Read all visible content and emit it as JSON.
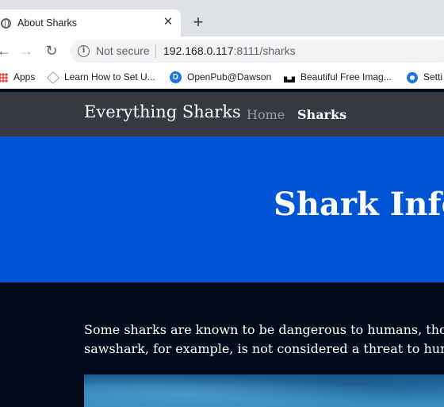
{
  "browser": {
    "tab_title": "About Sharks",
    "close_symbol": "✕",
    "new_tab_symbol": "+",
    "security_label": "Not secure",
    "url_host": "192.168.0.117",
    "url_rest": ":8111/sharks",
    "bookmarks": [
      {
        "label": "Apps",
        "icon": "apps-icon"
      },
      {
        "label": "Learn How to Set U...",
        "icon": "cube-icon"
      },
      {
        "label": "OpenPub@Dawson",
        "icon": "dawson-d-icon"
      },
      {
        "label": "Beautiful Free Imag...",
        "icon": "unsplash-icon"
      },
      {
        "label": "Setti",
        "icon": "gear-icon"
      }
    ]
  },
  "site": {
    "brand": "Everything Sharks",
    "nav": {
      "home": "Home",
      "sharks": "Sharks"
    },
    "hero_title": "Shark Info",
    "intro_line1": "Some sharks are known to be dangerous to humans, thoug",
    "intro_line2": "sawshark, for example, is not considered a threat to huma"
  },
  "colors": {
    "navbar": "#343a40",
    "hero": "#0055d4",
    "body": "#000a1a"
  }
}
